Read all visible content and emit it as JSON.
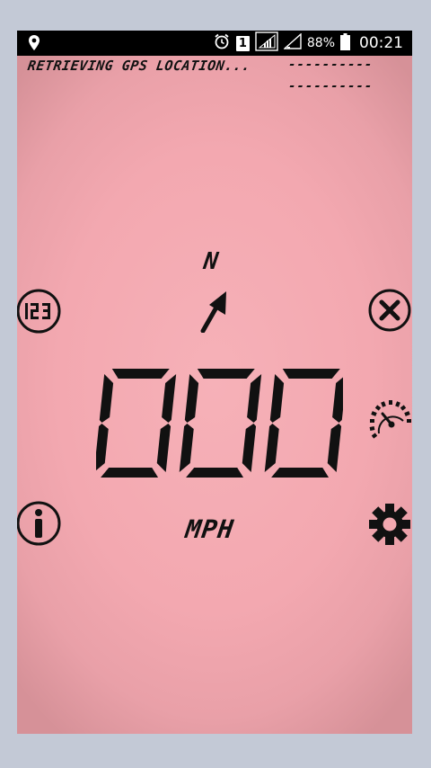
{
  "status_bar": {
    "battery_percent": "88%",
    "time": "00:21",
    "sim_slot": "1",
    "icons": [
      "location-pin-icon",
      "alarm-icon",
      "sim-slot-icon",
      "signal-icon",
      "signal-empty-icon",
      "battery-icon"
    ]
  },
  "gps": {
    "status_text": "RETRIEVING GPS LOCATION...",
    "latitude": "----------",
    "longitude": "----------"
  },
  "heading": {
    "direction": "N",
    "arrow_icon": "heading-arrow-icon"
  },
  "speed": {
    "value": "000",
    "unit": "MPH"
  },
  "buttons": {
    "left": [
      "digital-mode-icon",
      "info-icon"
    ],
    "right": [
      "close-icon",
      "analog-gauge-icon",
      "settings-gear-icon"
    ]
  },
  "colors": {
    "lcd_background": "#f3a8b0",
    "lcd_text": "#111111",
    "status_bar": "#000000",
    "page_background": "#c3c9d6"
  }
}
